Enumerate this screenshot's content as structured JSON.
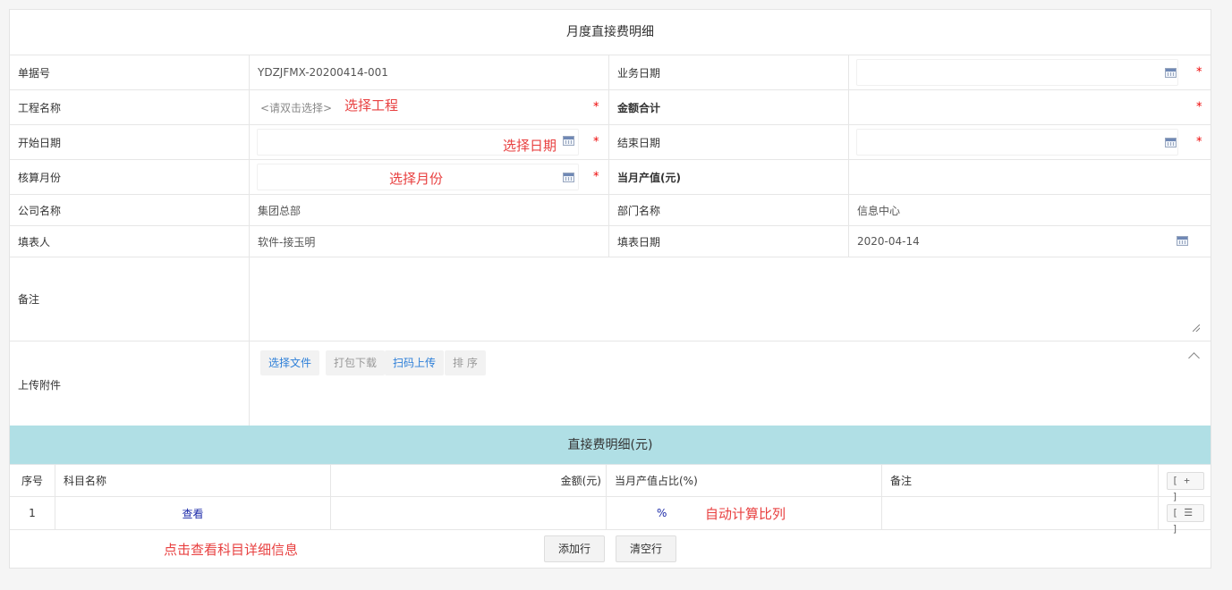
{
  "title": "月度直接费明细",
  "form": {
    "doc_no_label": "单据号",
    "doc_no_value": "YDZJFMX-20200414-001",
    "biz_date_label": "业务日期",
    "project_label": "工程名称",
    "project_placeholder": "<请双击选择>",
    "amount_total_label": "金额合计",
    "start_date_label": "开始日期",
    "end_date_label": "结束日期",
    "acct_month_label": "核算月份",
    "month_output_label": "当月产值(元)",
    "company_label": "公司名称",
    "company_value": "集团总部",
    "dept_label": "部门名称",
    "dept_value": "信息中心",
    "filler_label": "填表人",
    "filler_value": "软件-接玉明",
    "fill_date_label": "填表日期",
    "fill_date_value": "2020-04-14",
    "remark_label": "备注",
    "upload_label": "上传附件",
    "required_mark": "*"
  },
  "attachment_buttons": {
    "select_file": "选择文件",
    "pack_download": "打包下载",
    "scan_upload": "扫码上传",
    "sort": "排 序"
  },
  "annotations": {
    "select_project": "选择工程",
    "select_date": "选择日期",
    "select_month": "选择月份",
    "auto_calc": "自动计算比列",
    "click_view": "点击查看科目详细信息"
  },
  "detail": {
    "title": "直接费明细(元)",
    "columns": [
      "序号",
      "科目名称",
      "金额(元)",
      "当月产值占比(%)",
      "备注"
    ],
    "add_row_icon": "[ + ]",
    "row_menu_icon": "[ ☰ ]",
    "rows": [
      {
        "index": "1",
        "subject": "查看",
        "amount": "",
        "ratio": "%",
        "remark": ""
      }
    ],
    "add_row_button": "添加行",
    "clear_row_button": "清空行"
  },
  "colors": {
    "header_bg": "#b0dfe5",
    "annotation": "#e84040",
    "required": "#e00000",
    "link": "#1b2aa8"
  }
}
